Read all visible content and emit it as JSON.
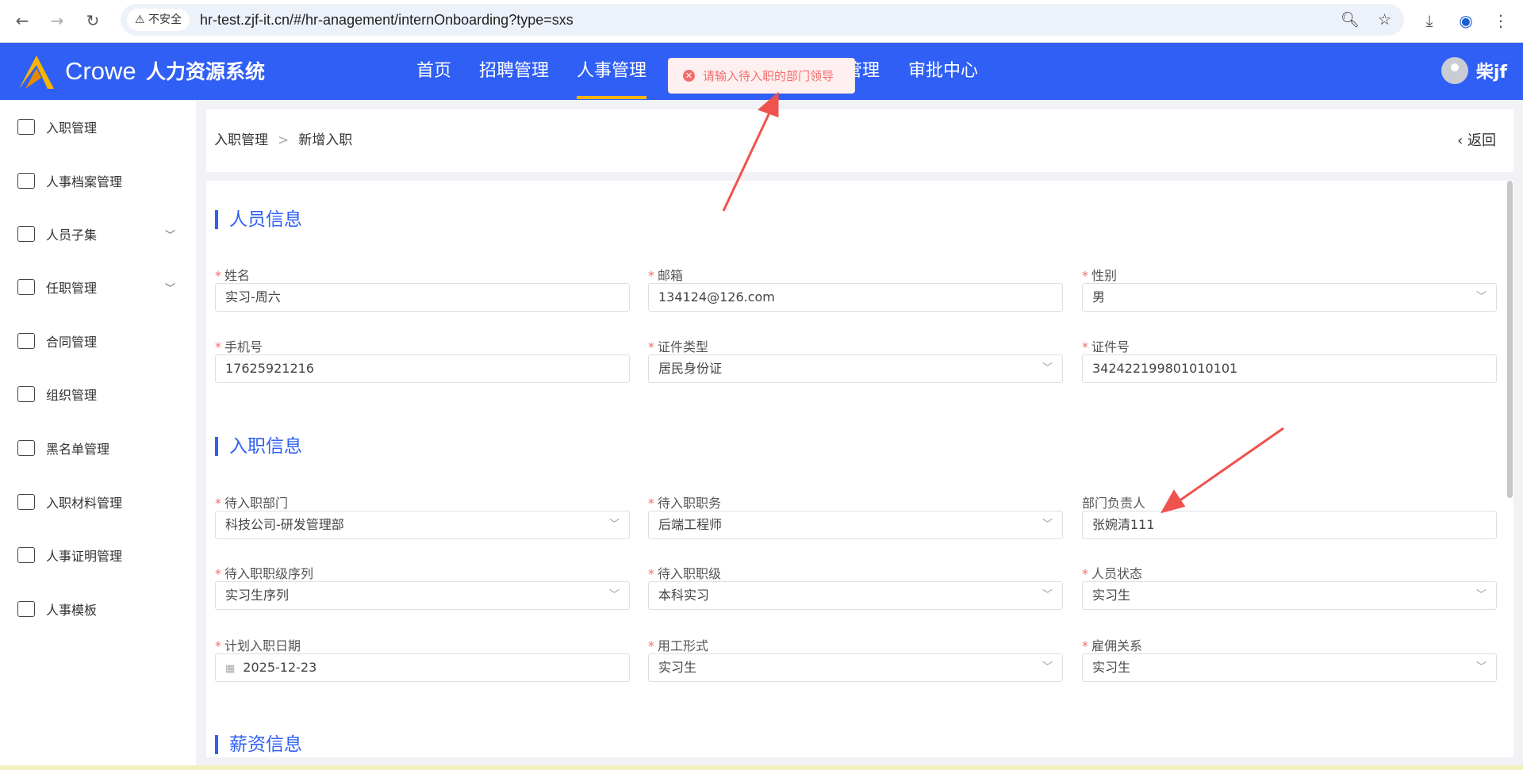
{
  "browser": {
    "security": "不安全",
    "url": "hr-test.zjf-it.cn/#/hr-anagement/internOnboarding?type=sxs"
  },
  "header": {
    "brand": "Crowe",
    "system": "人力资源系统",
    "nav": [
      "首页",
      "招聘管理",
      "人事管理",
      "管理",
      "审批中心"
    ],
    "active": "人事管理",
    "user": "柴jf"
  },
  "toast": {
    "message": "请输入待入职的部门领导",
    "type": "error"
  },
  "sidebar": {
    "items": [
      {
        "label": "入职管理",
        "icon": "user-add-icon"
      },
      {
        "label": "人事档案管理",
        "icon": "document-icon"
      },
      {
        "label": "人员子集",
        "icon": "users-icon",
        "expand": true
      },
      {
        "label": "任职管理",
        "icon": "briefcase-icon",
        "expand": true
      },
      {
        "label": "合同管理",
        "icon": "contract-icon"
      },
      {
        "label": "组织管理",
        "icon": "org-chart-icon"
      },
      {
        "label": "黑名单管理",
        "icon": "user-block-icon"
      },
      {
        "label": "入职材料管理",
        "icon": "books-icon"
      },
      {
        "label": "人事证明管理",
        "icon": "certificate-icon"
      },
      {
        "label": "人事模板",
        "icon": "template-icon"
      }
    ]
  },
  "breadcrumb": {
    "parent": "入职管理",
    "current": "新增入职",
    "back": "返回"
  },
  "sections": [
    {
      "title": "人员信息",
      "fields": [
        {
          "label": "姓名",
          "required": true,
          "value": "实习-周六",
          "select": false
        },
        {
          "label": "邮箱",
          "required": true,
          "value": "134124@126.com",
          "select": false
        },
        {
          "label": "性别",
          "required": true,
          "value": "男",
          "select": true
        },
        {
          "label": "手机号",
          "required": true,
          "value": "17625921216",
          "select": false
        },
        {
          "label": "证件类型",
          "required": true,
          "value": "居民身份证",
          "select": true
        },
        {
          "label": "证件号",
          "required": true,
          "value": "342422199801010101",
          "select": false
        }
      ]
    },
    {
      "title": "入职信息",
      "fields": [
        {
          "label": "待入职部门",
          "required": true,
          "value": "科技公司-研发管理部",
          "select": true
        },
        {
          "label": "待入职职务",
          "required": true,
          "value": "后端工程师",
          "select": true
        },
        {
          "label": "部门负责人",
          "required": false,
          "value": "张婉清111",
          "select": false
        },
        {
          "label": "待入职职级序列",
          "required": true,
          "value": "实习生序列",
          "select": true
        },
        {
          "label": "待入职职级",
          "required": true,
          "value": "本科实习",
          "select": true
        },
        {
          "label": "人员状态",
          "required": true,
          "value": "实习生",
          "select": true
        },
        {
          "label": "计划入职日期",
          "required": true,
          "value": "2025-12-23",
          "select": false,
          "date": true
        },
        {
          "label": "用工形式",
          "required": true,
          "value": "实习生",
          "select": true
        },
        {
          "label": "雇佣关系",
          "required": true,
          "value": "实习生",
          "select": true
        }
      ]
    },
    {
      "title": "薪资信息",
      "fields": []
    }
  ],
  "colors": {
    "primary": "#2f5ff5",
    "error": "#f56c6c",
    "accent": "#f7b500"
  }
}
